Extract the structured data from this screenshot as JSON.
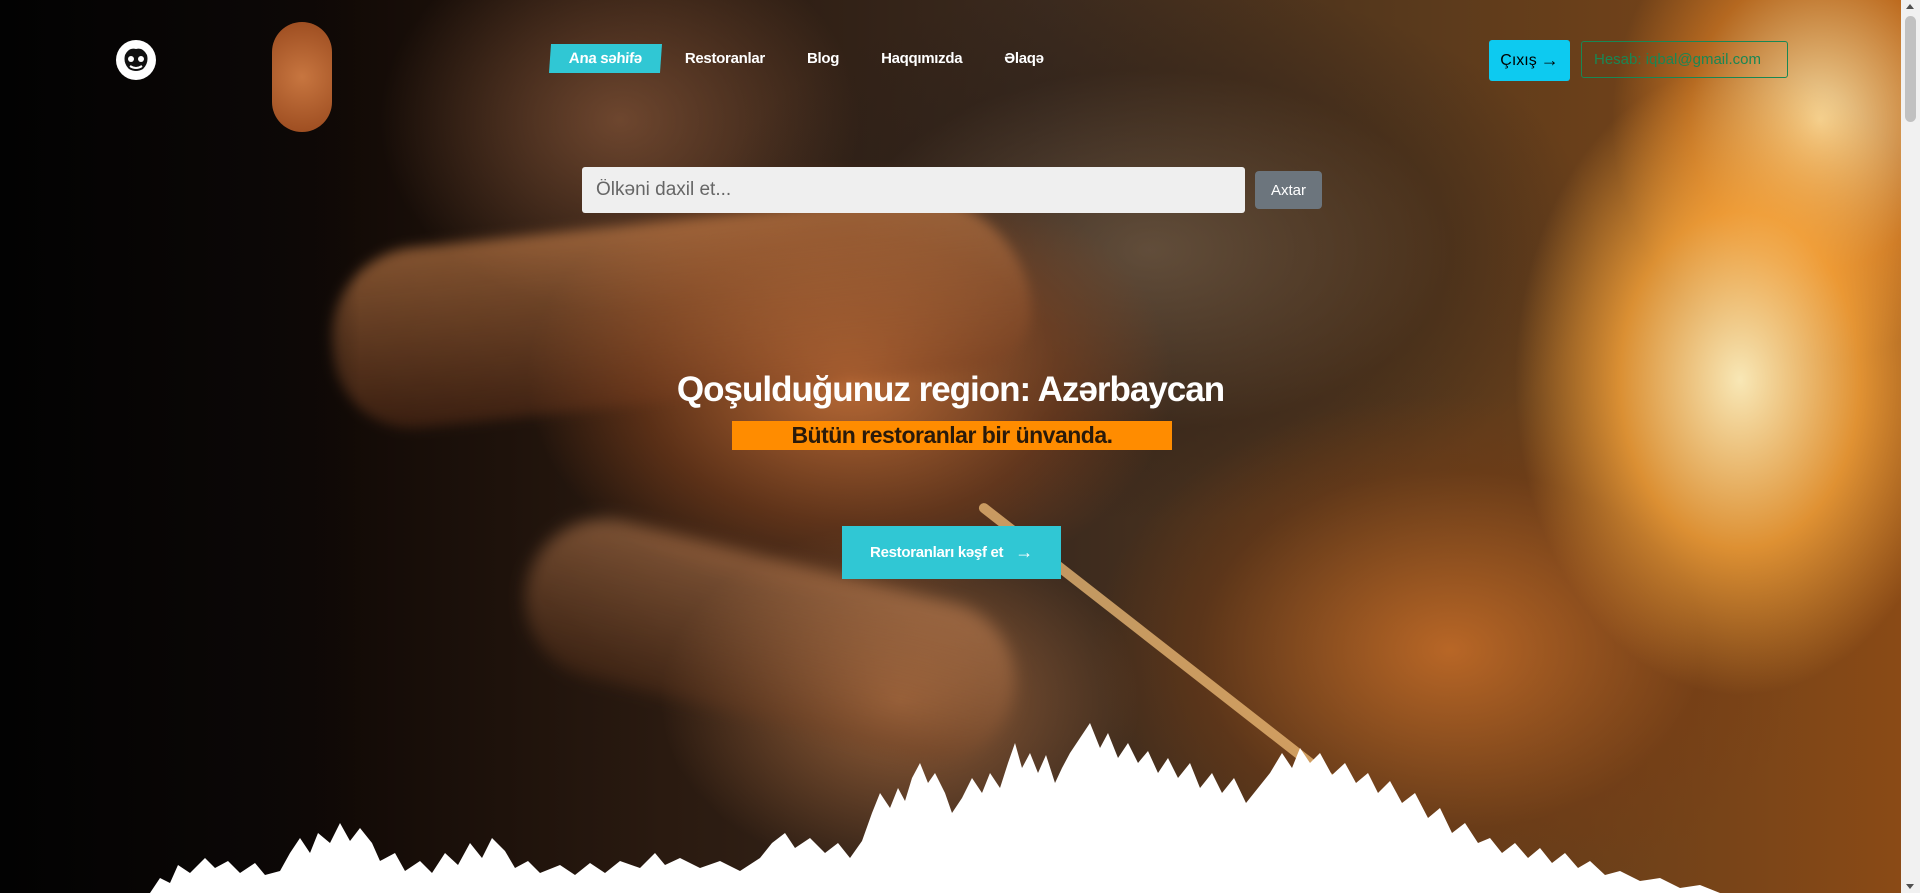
{
  "nav": {
    "logo_icon": "chef-face-icon",
    "items": [
      {
        "label": "Ana səhifə",
        "active": true
      },
      {
        "label": "Restoranlar",
        "active": false
      },
      {
        "label": "Blog",
        "active": false
      },
      {
        "label": "Haqqımızda",
        "active": false
      },
      {
        "label": "Əlaqə",
        "active": false
      }
    ],
    "logout_label": "Çıxış",
    "logout_icon": "arrow-right-icon",
    "account_label": "Hesab: iqbal@gmail.com"
  },
  "search": {
    "placeholder": "Ölkəni daxil et...",
    "button_label": "Axtar"
  },
  "hero": {
    "title": "Qoşulduğunuz region: Azərbaycan",
    "subtitle": "Bütün restoranlar bir ünvanda.",
    "cta_label": "Restoranları kəşf et",
    "cta_icon": "arrow-right-icon"
  },
  "colors": {
    "accent": "#30c7d4",
    "orange": "#ff8c00",
    "logout_bg": "#0dcaf0",
    "account_border": "#198754",
    "search_btn": "#6c757d"
  }
}
